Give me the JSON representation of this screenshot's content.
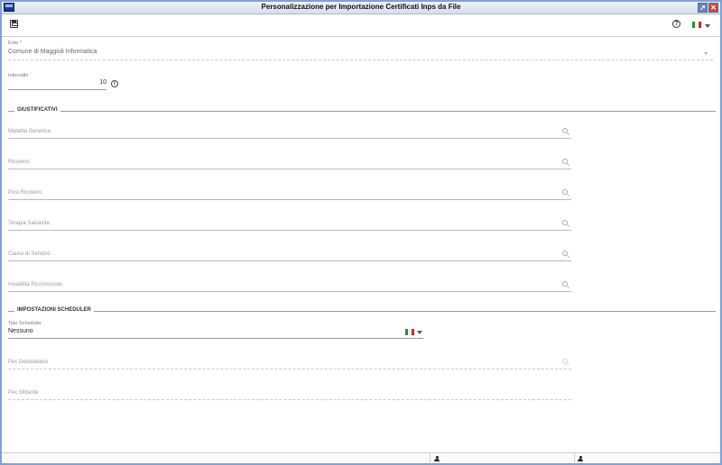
{
  "window": {
    "title": "Personalizzazione per Importazione Certificati Inps da File",
    "restore_label": "↗",
    "close_label": "✕"
  },
  "toolbar": {
    "save_icon": "save-icon",
    "help_icon": "help-icon",
    "help_glyph": "?",
    "language_flag": "italian-flag-icon"
  },
  "form": {
    "ente": {
      "label": "Ente *",
      "value": "Comune di Maggioli Informatica"
    },
    "intervallo": {
      "label": "Intervallo",
      "value": "10",
      "info_glyph": "i"
    },
    "giustificativi": {
      "title": "GIUSTIFICATIVI",
      "fields": [
        {
          "placeholder": "Malattia Generica"
        },
        {
          "placeholder": "Ricovero"
        },
        {
          "placeholder": "Post Ricovero"
        },
        {
          "placeholder": "Terapia Salvavita"
        },
        {
          "placeholder": "Cause di Servizio"
        },
        {
          "placeholder": "Invalidità Riconosciuta"
        }
      ]
    },
    "scheduler": {
      "title": "IMPOSTAZIONI SCHEDULER",
      "tipo_label": "Tipo Scheduler",
      "tipo_value": "Nessuno",
      "pec_destinatario": "Pec Destinatario",
      "pec_mittente": "Pec Mittente"
    }
  },
  "colors": {
    "window_border": "#7ea2d6",
    "underline": "#bbbbbb",
    "flag_green": "#2e8b3d",
    "flag_red": "#cf2b2b"
  }
}
